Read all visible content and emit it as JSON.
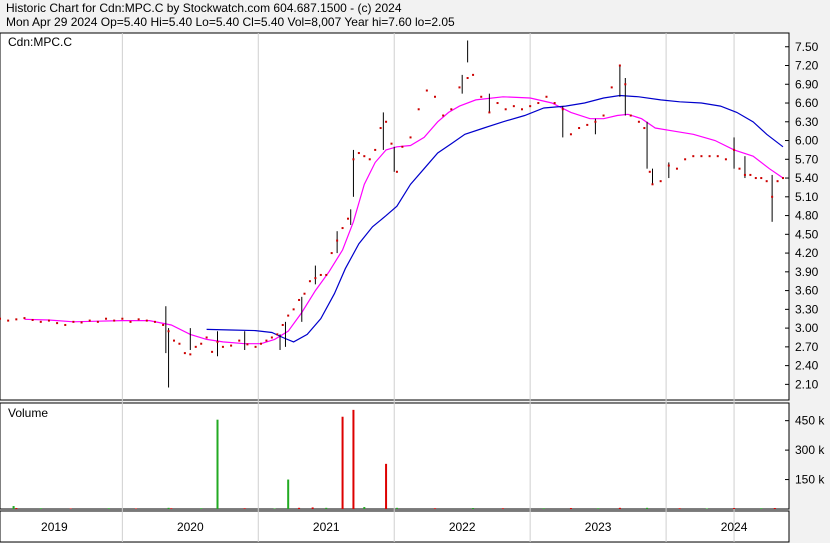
{
  "header": {
    "line1": "Historic Chart for Cdn:MPC.C by Stockwatch.com 604.687.1500 - (c) 2024",
    "line2": "Mon Apr 29 2024  Op=5.40  Hi=5.40  Lo=5.40  Cl=5.40  Vol=8,007  Year hi=7.60  lo=2.05"
  },
  "price_panel": {
    "symbol_label": "Cdn:MPC.C"
  },
  "volume_panel": {
    "label": "Volume"
  },
  "colors": {
    "background": "#f2f2f2",
    "panel": "#ffffff",
    "price_bar": "#000000",
    "close_dot": "#cc0000",
    "ma_short": "#ff00ff",
    "ma_long": "#0000cc",
    "volume_up": "#22aa22",
    "volume_down": "#dd0000",
    "grid": "#cfcfcf"
  },
  "chart_data": {
    "type": "line",
    "price_axis": {
      "ticks": [
        "7.50",
        "7.20",
        "6.90",
        "6.60",
        "6.30",
        "6.00",
        "5.70",
        "5.40",
        "5.10",
        "4.80",
        "4.50",
        "4.20",
        "3.90",
        "3.60",
        "3.30",
        "3.00",
        "2.70",
        "2.40",
        "2.10"
      ],
      "range": [
        1.85,
        7.72
      ]
    },
    "volume_axis": {
      "ticks": [
        {
          "label": "450 k",
          "value": 450
        },
        {
          "label": "300 k",
          "value": 300
        },
        {
          "label": "150 k",
          "value": 150
        }
      ],
      "range": [
        0,
        540
      ]
    },
    "x_axis": {
      "range": [
        2018.6,
        2024.36
      ],
      "year_labels": [
        {
          "label": "2019",
          "x": 2019.0
        },
        {
          "label": "2020",
          "x": 2020.0
        },
        {
          "label": "2021",
          "x": 2021.0
        },
        {
          "label": "2022",
          "x": 2022.0
        },
        {
          "label": "2023",
          "x": 2023.0
        },
        {
          "label": "2024",
          "x": 2024.0
        }
      ],
      "dividers": [
        2019.5,
        2020.5,
        2021.5,
        2022.5,
        2023.5,
        2024.0
      ]
    },
    "close_points": [
      [
        2018.6,
        3.15
      ],
      [
        2018.66,
        3.12
      ],
      [
        2018.72,
        3.14
      ],
      [
        2018.78,
        3.16
      ],
      [
        2018.84,
        3.13
      ],
      [
        2018.9,
        3.1
      ],
      [
        2018.96,
        3.12
      ],
      [
        2019.02,
        3.08
      ],
      [
        2019.08,
        3.05
      ],
      [
        2019.14,
        3.1
      ],
      [
        2019.2,
        3.09
      ],
      [
        2019.26,
        3.12
      ],
      [
        2019.32,
        3.1
      ],
      [
        2019.38,
        3.15
      ],
      [
        2019.44,
        3.12
      ],
      [
        2019.5,
        3.15
      ],
      [
        2019.56,
        3.1
      ],
      [
        2019.62,
        3.14
      ],
      [
        2019.68,
        3.12
      ],
      [
        2019.74,
        3.1
      ],
      [
        2019.8,
        3.05
      ],
      [
        2019.84,
        2.95
      ],
      [
        2019.88,
        2.8
      ],
      [
        2019.92,
        2.75
      ],
      [
        2019.96,
        2.6
      ],
      [
        2020.0,
        2.58
      ],
      [
        2020.04,
        2.7
      ],
      [
        2020.08,
        2.75
      ],
      [
        2020.12,
        2.85
      ],
      [
        2020.16,
        2.62
      ],
      [
        2020.2,
        2.78
      ],
      [
        2020.24,
        2.7
      ],
      [
        2020.3,
        2.72
      ],
      [
        2020.36,
        2.8
      ],
      [
        2020.42,
        2.74
      ],
      [
        2020.48,
        2.7
      ],
      [
        2020.52,
        2.75
      ],
      [
        2020.56,
        2.8
      ],
      [
        2020.6,
        2.85
      ],
      [
        2020.64,
        2.9
      ],
      [
        2020.68,
        3.05
      ],
      [
        2020.72,
        3.2
      ],
      [
        2020.76,
        3.3
      ],
      [
        2020.8,
        3.45
      ],
      [
        2020.84,
        3.55
      ],
      [
        2020.88,
        3.75
      ],
      [
        2020.92,
        3.8
      ],
      [
        2020.96,
        3.85
      ],
      [
        2021.0,
        3.85
      ],
      [
        2021.04,
        4.2
      ],
      [
        2021.08,
        4.4
      ],
      [
        2021.12,
        4.6
      ],
      [
        2021.16,
        4.75
      ],
      [
        2021.2,
        5.7
      ],
      [
        2021.24,
        5.8
      ],
      [
        2021.28,
        5.75
      ],
      [
        2021.32,
        5.7
      ],
      [
        2021.36,
        5.85
      ],
      [
        2021.4,
        6.2
      ],
      [
        2021.44,
        6.3
      ],
      [
        2021.48,
        5.95
      ],
      [
        2021.52,
        5.5
      ],
      [
        2021.56,
        5.9
      ],
      [
        2021.62,
        6.05
      ],
      [
        2021.68,
        6.5
      ],
      [
        2021.74,
        6.8
      ],
      [
        2021.8,
        6.7
      ],
      [
        2021.86,
        6.4
      ],
      [
        2021.92,
        6.5
      ],
      [
        2021.98,
        6.85
      ],
      [
        2022.04,
        7.0
      ],
      [
        2022.08,
        7.05
      ],
      [
        2022.14,
        6.7
      ],
      [
        2022.2,
        6.45
      ],
      [
        2022.26,
        6.6
      ],
      [
        2022.32,
        6.5
      ],
      [
        2022.38,
        6.55
      ],
      [
        2022.44,
        6.5
      ],
      [
        2022.5,
        6.55
      ],
      [
        2022.56,
        6.6
      ],
      [
        2022.62,
        6.7
      ],
      [
        2022.68,
        6.6
      ],
      [
        2022.74,
        6.5
      ],
      [
        2022.8,
        6.1
      ],
      [
        2022.86,
        6.2
      ],
      [
        2022.92,
        6.25
      ],
      [
        2022.98,
        6.3
      ],
      [
        2023.04,
        6.4
      ],
      [
        2023.1,
        6.85
      ],
      [
        2023.16,
        7.2
      ],
      [
        2023.2,
        6.9
      ],
      [
        2023.24,
        6.4
      ],
      [
        2023.3,
        6.3
      ],
      [
        2023.34,
        6.2
      ],
      [
        2023.38,
        5.5
      ],
      [
        2023.4,
        5.3
      ],
      [
        2023.46,
        5.35
      ],
      [
        2023.52,
        5.6
      ],
      [
        2023.58,
        5.55
      ],
      [
        2023.64,
        5.7
      ],
      [
        2023.7,
        5.75
      ],
      [
        2023.76,
        5.75
      ],
      [
        2023.82,
        5.75
      ],
      [
        2023.88,
        5.75
      ],
      [
        2023.94,
        5.7
      ],
      [
        2024.0,
        5.85
      ],
      [
        2024.04,
        5.55
      ],
      [
        2024.08,
        5.45
      ],
      [
        2024.12,
        5.45
      ],
      [
        2024.16,
        5.4
      ],
      [
        2024.2,
        5.4
      ],
      [
        2024.24,
        5.35
      ],
      [
        2024.28,
        5.1
      ],
      [
        2024.32,
        5.35
      ],
      [
        2024.36,
        5.4
      ]
    ],
    "price_bars": [
      [
        2019.82,
        2.6,
        3.35
      ],
      [
        2019.84,
        2.05,
        3.0
      ],
      [
        2020.0,
        2.65,
        3.0
      ],
      [
        2020.2,
        2.55,
        2.95
      ],
      [
        2020.4,
        2.65,
        2.95
      ],
      [
        2020.66,
        2.65,
        2.9
      ],
      [
        2020.7,
        2.7,
        3.1
      ],
      [
        2020.82,
        3.1,
        3.5
      ],
      [
        2020.92,
        3.7,
        4.0
      ],
      [
        2021.08,
        4.2,
        4.55
      ],
      [
        2021.18,
        4.65,
        4.9
      ],
      [
        2021.2,
        5.1,
        5.85
      ],
      [
        2021.42,
        5.85,
        6.45
      ],
      [
        2021.5,
        5.5,
        5.9
      ],
      [
        2022.0,
        6.75,
        7.05
      ],
      [
        2022.04,
        7.25,
        7.6
      ],
      [
        2022.2,
        6.45,
        6.75
      ],
      [
        2022.74,
        6.05,
        6.55
      ],
      [
        2022.98,
        6.1,
        6.35
      ],
      [
        2023.16,
        6.7,
        7.2
      ],
      [
        2023.2,
        6.4,
        7.0
      ],
      [
        2023.36,
        5.55,
        6.3
      ],
      [
        2023.4,
        5.3,
        5.55
      ],
      [
        2023.52,
        5.4,
        5.65
      ],
      [
        2024.0,
        5.55,
        6.05
      ],
      [
        2024.08,
        5.4,
        5.75
      ],
      [
        2024.28,
        4.7,
        5.45
      ]
    ],
    "series": [
      {
        "name": "",
        "color": "#ff00ff",
        "points": [
          [
            2018.78,
            3.14
          ],
          [
            2018.96,
            3.13
          ],
          [
            2019.14,
            3.1
          ],
          [
            2019.32,
            3.11
          ],
          [
            2019.5,
            3.12
          ],
          [
            2019.7,
            3.12
          ],
          [
            2019.86,
            3.05
          ],
          [
            2020.0,
            2.9
          ],
          [
            2020.12,
            2.82
          ],
          [
            2020.24,
            2.78
          ],
          [
            2020.4,
            2.75
          ],
          [
            2020.52,
            2.75
          ],
          [
            2020.62,
            2.82
          ],
          [
            2020.72,
            2.95
          ],
          [
            2020.82,
            3.25
          ],
          [
            2020.92,
            3.6
          ],
          [
            2021.02,
            3.9
          ],
          [
            2021.12,
            4.25
          ],
          [
            2021.2,
            4.7
          ],
          [
            2021.28,
            5.3
          ],
          [
            2021.36,
            5.65
          ],
          [
            2021.44,
            5.85
          ],
          [
            2021.52,
            5.9
          ],
          [
            2021.62,
            5.92
          ],
          [
            2021.72,
            6.05
          ],
          [
            2021.82,
            6.3
          ],
          [
            2021.9,
            6.45
          ],
          [
            2021.98,
            6.55
          ],
          [
            2022.1,
            6.65
          ],
          [
            2022.3,
            6.7
          ],
          [
            2022.5,
            6.68
          ],
          [
            2022.66,
            6.6
          ],
          [
            2022.8,
            6.45
          ],
          [
            2022.94,
            6.35
          ],
          [
            2023.04,
            6.35
          ],
          [
            2023.14,
            6.4
          ],
          [
            2023.22,
            6.42
          ],
          [
            2023.32,
            6.35
          ],
          [
            2023.42,
            6.2
          ],
          [
            2023.56,
            6.15
          ],
          [
            2023.7,
            6.1
          ],
          [
            2023.86,
            6.0
          ],
          [
            2024.0,
            5.85
          ],
          [
            2024.14,
            5.75
          ],
          [
            2024.26,
            5.55
          ],
          [
            2024.36,
            5.4
          ]
        ]
      },
      {
        "name": "",
        "color": "#0000cc",
        "points": [
          [
            2020.12,
            2.98
          ],
          [
            2020.3,
            2.97
          ],
          [
            2020.48,
            2.96
          ],
          [
            2020.6,
            2.93
          ],
          [
            2020.68,
            2.85
          ],
          [
            2020.76,
            2.78
          ],
          [
            2020.86,
            2.9
          ],
          [
            2020.96,
            3.15
          ],
          [
            2021.06,
            3.55
          ],
          [
            2021.14,
            3.95
          ],
          [
            2021.24,
            4.35
          ],
          [
            2021.34,
            4.62
          ],
          [
            2021.44,
            4.8
          ],
          [
            2021.52,
            4.95
          ],
          [
            2021.62,
            5.3
          ],
          [
            2021.72,
            5.55
          ],
          [
            2021.82,
            5.8
          ],
          [
            2021.92,
            5.95
          ],
          [
            2022.02,
            6.1
          ],
          [
            2022.16,
            6.2
          ],
          [
            2022.3,
            6.3
          ],
          [
            2022.46,
            6.4
          ],
          [
            2022.6,
            6.52
          ],
          [
            2022.76,
            6.55
          ],
          [
            2022.9,
            6.6
          ],
          [
            2023.04,
            6.68
          ],
          [
            2023.16,
            6.72
          ],
          [
            2023.3,
            6.7
          ],
          [
            2023.46,
            6.65
          ],
          [
            2023.6,
            6.62
          ],
          [
            2023.76,
            6.6
          ],
          [
            2023.9,
            6.55
          ],
          [
            2024.02,
            6.45
          ],
          [
            2024.14,
            6.3
          ],
          [
            2024.24,
            6.1
          ],
          [
            2024.36,
            5.9
          ]
        ]
      }
    ],
    "volume_bars": [
      [
        2018.7,
        15,
        "#22aa22"
      ],
      [
        2018.72,
        5,
        "#dd0000"
      ],
      [
        2018.9,
        4,
        "#22aa22"
      ],
      [
        2019.12,
        3,
        "#dd0000"
      ],
      [
        2019.4,
        4,
        "#22aa22"
      ],
      [
        2019.6,
        3,
        "#dd0000"
      ],
      [
        2019.84,
        6,
        "#22aa22"
      ],
      [
        2019.86,
        4,
        "#dd0000"
      ],
      [
        2020.08,
        4,
        "#22aa22"
      ],
      [
        2020.2,
        455,
        "#22aa22"
      ],
      [
        2020.4,
        4,
        "#dd0000"
      ],
      [
        2020.62,
        3,
        "#22aa22"
      ],
      [
        2020.72,
        150,
        "#22aa22"
      ],
      [
        2020.8,
        6,
        "#dd0000"
      ],
      [
        2020.9,
        8,
        "#dd0000"
      ],
      [
        2021.0,
        6,
        "#22aa22"
      ],
      [
        2021.12,
        470,
        "#dd0000"
      ],
      [
        2021.2,
        505,
        "#dd0000"
      ],
      [
        2021.28,
        10,
        "#22aa22"
      ],
      [
        2021.44,
        230,
        "#dd0000"
      ],
      [
        2021.52,
        6,
        "#22aa22"
      ],
      [
        2021.8,
        4,
        "#dd0000"
      ],
      [
        2022.08,
        5,
        "#22aa22"
      ],
      [
        2022.3,
        4,
        "#dd0000"
      ],
      [
        2022.6,
        4,
        "#22aa22"
      ],
      [
        2022.8,
        5,
        "#dd0000"
      ],
      [
        2023.0,
        4,
        "#22aa22"
      ],
      [
        2023.16,
        6,
        "#dd0000"
      ],
      [
        2023.36,
        6,
        "#22aa22"
      ],
      [
        2023.6,
        4,
        "#dd0000"
      ],
      [
        2023.8,
        3,
        "#22aa22"
      ],
      [
        2024.0,
        5,
        "#dd0000"
      ],
      [
        2024.2,
        4,
        "#22aa22"
      ],
      [
        2024.3,
        5,
        "#dd0000"
      ]
    ],
    "grid": true
  }
}
